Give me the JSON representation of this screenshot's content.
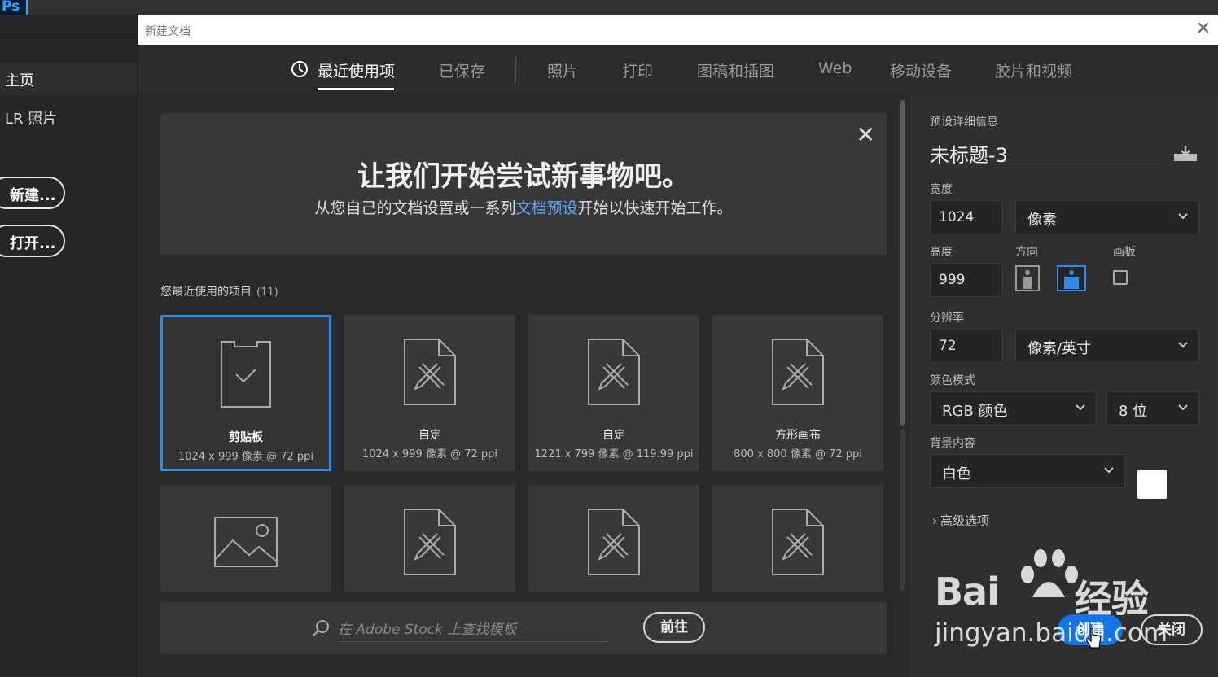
{
  "app": {
    "logo": "Ps"
  },
  "home": {
    "nav_home": "主页",
    "nav_lr": "LR 照片",
    "new_button": "新建...",
    "open_button": "打开..."
  },
  "dialog": {
    "title": "新建文档",
    "tabs": [
      {
        "label": "最近使用项",
        "active": true
      },
      {
        "label": "已保存"
      },
      {
        "label": "照片"
      },
      {
        "label": "打印"
      },
      {
        "label": "图稿和插图"
      },
      {
        "label": "Web"
      },
      {
        "label": "移动设备"
      },
      {
        "label": "胶片和视频"
      }
    ],
    "banner": {
      "title": "让我们开始尝试新事物吧。",
      "sub_before": "从您自己的文档设置或一系列",
      "sub_link": "文档预设",
      "sub_after": "开始以快速开始工作。"
    },
    "recent": {
      "label": "您最近使用的项目",
      "count": "(11)",
      "items": [
        {
          "name": "剪贴板",
          "meta": "1024 x 999 像素 @ 72 ppi",
          "icon": "clipboard-icon"
        },
        {
          "name": "自定",
          "meta": "1024 x 999 像素 @ 72 ppi",
          "icon": "document-pencil-icon"
        },
        {
          "name": "自定",
          "meta": "1221 x 799 像素 @ 119.99 ppi",
          "icon": "document-pencil-icon"
        },
        {
          "name": "方形画布",
          "meta": "800 x 800 像素 @ 72 ppi",
          "icon": "document-pencil-icon"
        }
      ]
    },
    "search": {
      "placeholder": "在 Adobe Stock 上查找模板",
      "go_button": "前往"
    }
  },
  "preset": {
    "section_label": "预设详细信息",
    "doc_name": "未标题-3",
    "width_label": "宽度",
    "width_value": "1024",
    "width_unit": "像素",
    "height_label": "高度",
    "height_value": "999",
    "orientation_label": "方向",
    "artboard_label": "画板",
    "resolution_label": "分辨率",
    "resolution_value": "72",
    "resolution_unit": "像素/英寸",
    "color_mode_label": "颜色模式",
    "color_mode": "RGB 颜色",
    "bit_depth": "8 位",
    "background_label": "背景内容",
    "background": "白色",
    "advanced": "高级选项",
    "create_button": "创建",
    "close_button": "关闭"
  },
  "watermark": {
    "line1": "Bai",
    "line1b": "经验",
    "line2": "jingyan.baidu.com"
  },
  "colors": {
    "accent": "#1473e6",
    "selection": "#2d8ceb",
    "link": "#5aa8ff"
  }
}
